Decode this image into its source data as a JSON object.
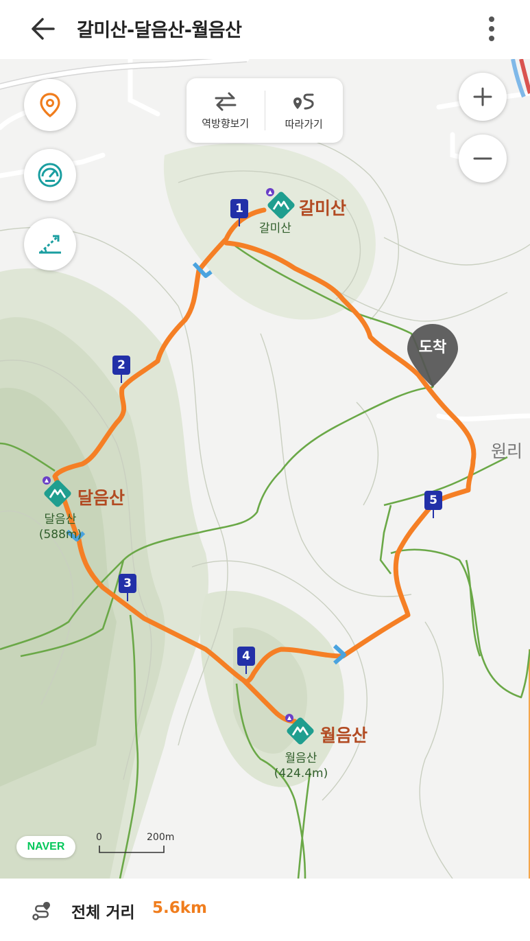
{
  "header": {
    "title": "갈미산-달음산-월음산",
    "back_icon": "arrow-left-icon",
    "more_icon": "more-vertical-icon"
  },
  "toolbar": {
    "reverse_label": "역방향보기",
    "follow_label": "따라가기"
  },
  "map": {
    "peaks": {
      "galmi": {
        "title": "갈미산",
        "sub": "갈미산"
      },
      "dalum": {
        "title": "달음산",
        "sub": "달음산",
        "elev": "(588m)"
      },
      "wolum": {
        "title": "월음산",
        "sub": "월음산",
        "elev": "(424.4m)"
      }
    },
    "place_label": "원리",
    "goal_label": "도착",
    "waypoints": [
      "1",
      "2",
      "3",
      "4",
      "5"
    ],
    "brand": "NAVER",
    "scale": {
      "zero": "0",
      "distance": "200m"
    },
    "colors": {
      "route": "#f57f25",
      "trail": "#6aa847",
      "waypoint": "#2230a8",
      "peak_icon": "#1f9e8f"
    }
  },
  "footer": {
    "label": "전체 거리",
    "value": "5.6km",
    "icon": "route-icon"
  }
}
